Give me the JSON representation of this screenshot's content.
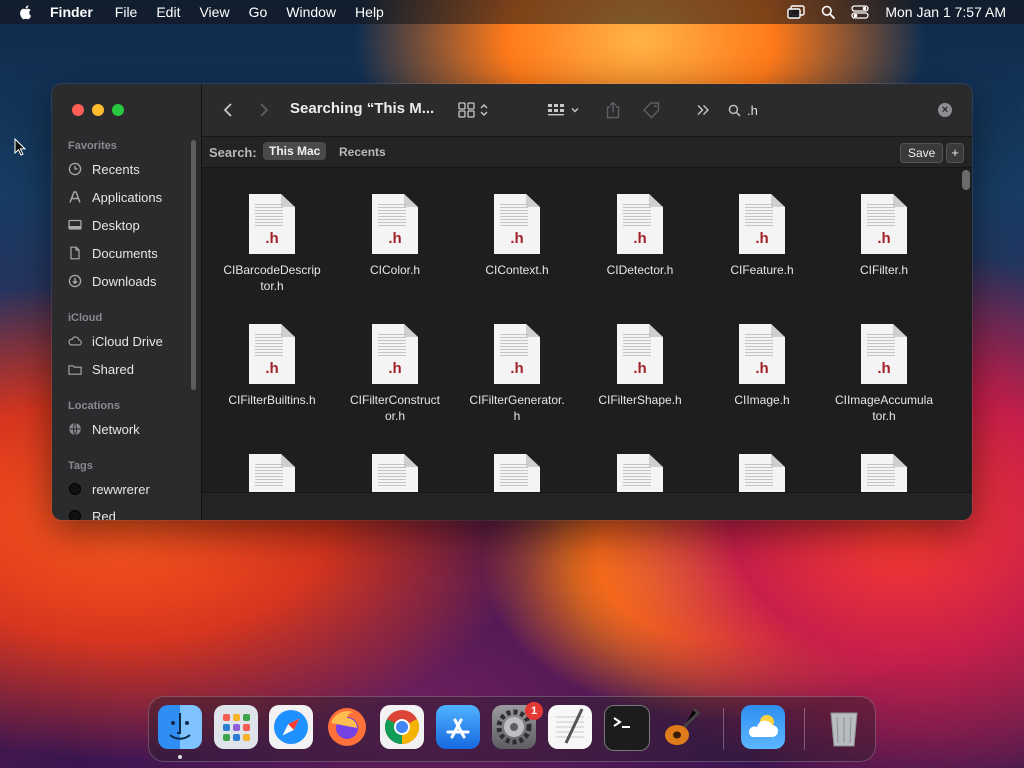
{
  "menubar": {
    "app_name": "Finder",
    "items": [
      "File",
      "Edit",
      "View",
      "Go",
      "Window",
      "Help"
    ],
    "clock": "Mon Jan 1  7:57 AM",
    "icons": [
      "screen-mirroring-icon",
      "spotlight-search-icon",
      "control-center-icon"
    ]
  },
  "sidebar": {
    "favorites_header": "Favorites",
    "favorites": [
      {
        "label": "Recents",
        "icon": "clock-icon"
      },
      {
        "label": "Applications",
        "icon": "applications-icon"
      },
      {
        "label": "Desktop",
        "icon": "desktop-icon"
      },
      {
        "label": "Documents",
        "icon": "document-icon"
      },
      {
        "label": "Downloads",
        "icon": "download-icon"
      }
    ],
    "icloud_header": "iCloud",
    "icloud": [
      {
        "label": "iCloud Drive",
        "icon": "cloud-icon"
      },
      {
        "label": "Shared",
        "icon": "shared-folder-icon"
      }
    ],
    "locations_header": "Locations",
    "locations": [
      {
        "label": "Network",
        "icon": "globe-icon"
      }
    ],
    "tags_header": "Tags",
    "tags": [
      {
        "label": "rewwrerer",
        "color": "#1a1a1a"
      },
      {
        "label": "Red",
        "color": "#1a1a1a"
      }
    ]
  },
  "toolbar": {
    "title": "Searching “This M...",
    "search_value": ".h"
  },
  "scope": {
    "label": "Search:",
    "this_mac": "This Mac",
    "recents": "Recents",
    "save": "Save",
    "plus": "+"
  },
  "file_ext": ".h",
  "files": [
    {
      "name": "CIBarcodeDescriptor.h",
      "display": [
        "CIBarcodeDescrip",
        "tor.h"
      ]
    },
    {
      "name": "CIColor.h",
      "display": [
        "CIColor.h"
      ]
    },
    {
      "name": "CIContext.h",
      "display": [
        "CIContext.h"
      ]
    },
    {
      "name": "CIDetector.h",
      "display": [
        "CIDetector.h"
      ]
    },
    {
      "name": "CIFeature.h",
      "display": [
        "CIFeature.h"
      ]
    },
    {
      "name": "CIFilter.h",
      "display": [
        "CIFilter.h"
      ]
    },
    {
      "name": "CIFilterBuiltins.h",
      "display": [
        "CIFilterBuiltins.h"
      ]
    },
    {
      "name": "CIFilterConstructor.h",
      "display": [
        "CIFilterConstruct",
        "or.h"
      ]
    },
    {
      "name": "CIFilterGenerator.h",
      "display": [
        "CIFilterGenerator.",
        "h"
      ]
    },
    {
      "name": "CIFilterShape.h",
      "display": [
        "CIFilterShape.h"
      ]
    },
    {
      "name": "CIImage.h",
      "display": [
        "CIImage.h"
      ]
    },
    {
      "name": "CIImageAccumulator.h",
      "display": [
        "CIImageAccumula",
        "tor.h"
      ]
    }
  ],
  "dock": {
    "apps": [
      "finder",
      "launchpad",
      "safari",
      "firefox",
      "chrome",
      "app-store",
      "system-settings",
      "textedit",
      "terminal",
      "garageband",
      "weather",
      "trash"
    ],
    "system_settings_badge": "1"
  }
}
